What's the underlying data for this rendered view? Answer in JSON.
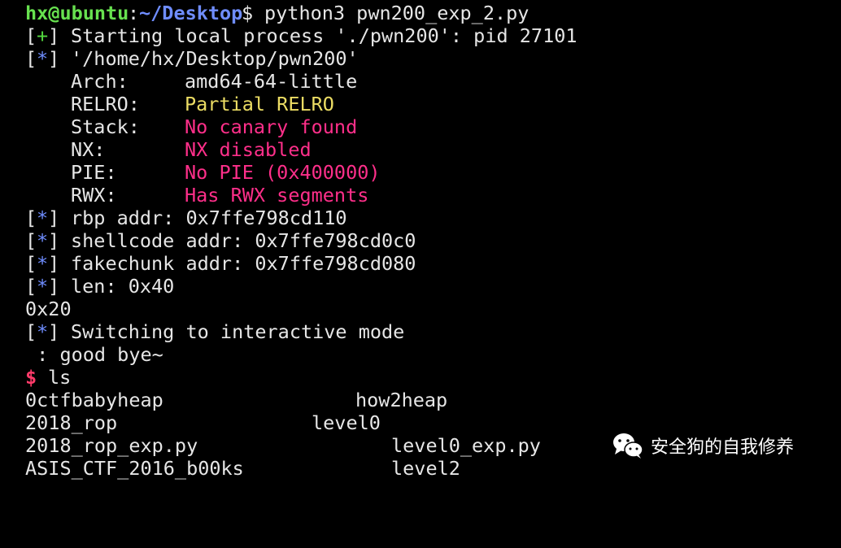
{
  "terminal": {
    "prompt": {
      "user_host": "hx@ubuntu",
      "colon": ":",
      "path": "~/Desktop",
      "dollar": "$",
      "command": "python3 pwn200_exp_2.py"
    },
    "line_start": {
      "open": "[",
      "mark": "+",
      "close": "]",
      "text": "Starting local process './pwn200': pid 27101"
    },
    "line_binary": {
      "open": "[",
      "mark": "*",
      "close": "]",
      "text": "'/home/hx/Desktop/pwn200'"
    },
    "checksec": [
      {
        "label": "Arch:",
        "value": "amd64-64-little",
        "color": "#e6e6e6"
      },
      {
        "label": "RELRO:",
        "value": "Partial RELRO",
        "color": "#ecdd64"
      },
      {
        "label": "Stack:",
        "value": "No canary found",
        "color": "#ff2f8a"
      },
      {
        "label": "NX:",
        "value": "NX disabled",
        "color": "#ff2f8a"
      },
      {
        "label": "PIE:",
        "value": "No PIE (0x400000)",
        "color": "#ff2f8a"
      },
      {
        "label": "RWX:",
        "value": "Has RWX segments",
        "color": "#ff2f8a"
      }
    ],
    "info_lines": [
      {
        "text": "rbp addr: 0x7ffe798cd110"
      },
      {
        "text": "shellcode addr: 0x7ffe798cd0c0"
      },
      {
        "text": "fakechunk addr: 0x7ffe798cd080"
      },
      {
        "text": "len: 0x40"
      }
    ],
    "output_0x20": "0x20",
    "line_switch": {
      "text": "Switching to interactive mode"
    },
    "goodbye": " : good bye~",
    "shell_prompt": {
      "dollar": "$",
      "command": "ls"
    },
    "ls_rows": [
      {
        "left": "0ctfbabyheap",
        "right": "how2heap"
      },
      {
        "left": "2018_rop",
        "right": "level0"
      },
      {
        "left": "2018_rop_exp.py",
        "right": "level0_exp.py"
      },
      {
        "left": "ASIS_CTF_2016_b00ks",
        "right": "level2"
      }
    ]
  },
  "watermark": {
    "icon": "wechat-icon",
    "text": "安全狗的自我修养"
  }
}
